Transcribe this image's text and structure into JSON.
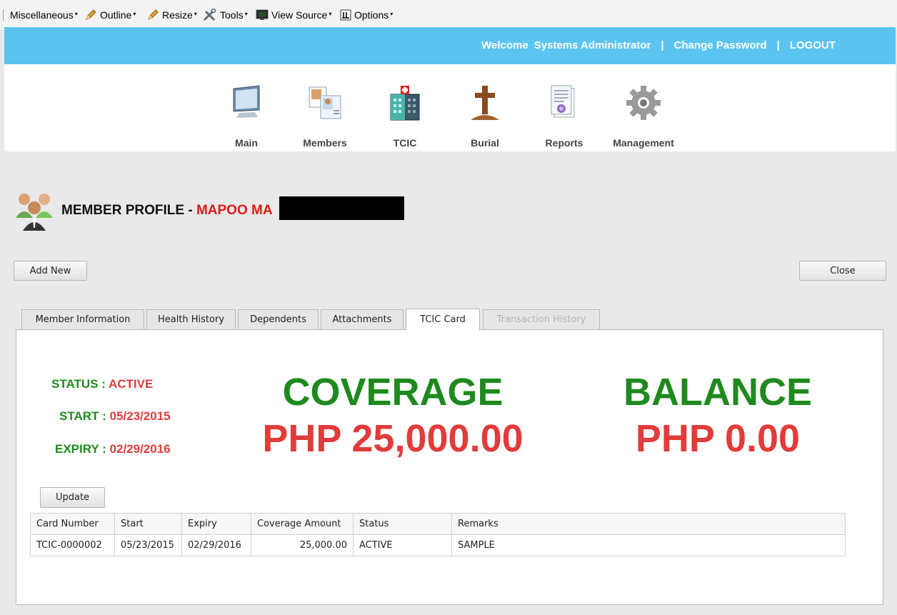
{
  "toolbar": {
    "items": [
      {
        "label": "Miscellaneous",
        "icon": "none"
      },
      {
        "label": "Outline",
        "icon": "pencil-icon"
      },
      {
        "label": "Resize",
        "icon": "pencil-icon"
      },
      {
        "label": "Tools",
        "icon": "tools-icon"
      },
      {
        "label": "View Source",
        "icon": "monitor-icon"
      },
      {
        "label": "Options",
        "icon": "options-icon"
      }
    ]
  },
  "header": {
    "welcome": "Welcome",
    "user": "Systems Administrator",
    "separator": "|",
    "change_password": "Change Password",
    "logout": "LOGOUT",
    "bg_color": "#5bc4f0"
  },
  "nav": {
    "items": [
      {
        "label": "Main",
        "icon": "monitor-icon"
      },
      {
        "label": "Members",
        "icon": "members-icon"
      },
      {
        "label": "TCIC",
        "icon": "hospital-icon"
      },
      {
        "label": "Burial",
        "icon": "cross-icon"
      },
      {
        "label": "Reports",
        "icon": "reports-icon"
      },
      {
        "label": "Management",
        "icon": "gear-icon"
      }
    ]
  },
  "page": {
    "title_prefix": "MEMBER PROFILE - ",
    "member_name": "MAPOO MA",
    "add_new": "Add New",
    "close": "Close"
  },
  "tabs": [
    {
      "label": "Member Information",
      "state": "normal"
    },
    {
      "label": "Health History",
      "state": "normal"
    },
    {
      "label": "Dependents",
      "state": "normal"
    },
    {
      "label": "Attachments",
      "state": "normal"
    },
    {
      "label": "TCIC Card",
      "state": "active"
    },
    {
      "label": "Transaction History",
      "state": "disabled"
    }
  ],
  "card": {
    "status_label": "STATUS : ",
    "status_value": "ACTIVE",
    "start_label": "START : ",
    "start_value": "05/23/2015",
    "expiry_label": "EXPIRY : ",
    "expiry_value": "02/29/2016",
    "coverage_label": "COVERAGE",
    "coverage_value": "PHP 25,000.00",
    "balance_label": "BALANCE",
    "balance_value": "PHP 0.00",
    "update": "Update",
    "green": "#1e8a1e",
    "red": "#e23b3b"
  },
  "table": {
    "headers": [
      "Card Number",
      "Start",
      "Expiry",
      "Coverage Amount",
      "Status",
      "Remarks"
    ],
    "rows": [
      [
        "TCIC-0000002",
        "05/23/2015",
        "02/29/2016",
        "25,000.00",
        "ACTIVE",
        "SAMPLE"
      ]
    ]
  }
}
